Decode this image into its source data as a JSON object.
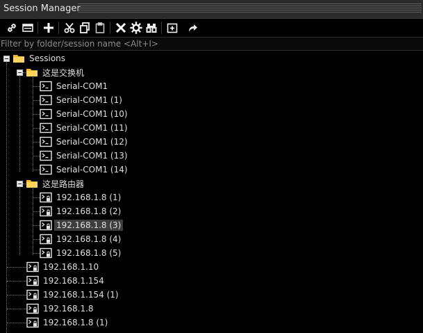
{
  "window": {
    "title": "Session Manager"
  },
  "toolbar": {
    "buttons": [
      {
        "icon": "link-icon",
        "tooltip": "Connect"
      },
      {
        "icon": "tab-icon",
        "tooltip": "Connect in Tab"
      },
      {
        "icon": "plus-icon",
        "tooltip": "New Session"
      },
      {
        "icon": "scissors-icon",
        "tooltip": "Cut"
      },
      {
        "icon": "copy-icon",
        "tooltip": "Copy"
      },
      {
        "icon": "paste-icon",
        "tooltip": "Paste"
      },
      {
        "icon": "delete-x-icon",
        "tooltip": "Delete"
      },
      {
        "icon": "gear-icon",
        "tooltip": "Properties"
      },
      {
        "icon": "binoculars-icon",
        "tooltip": "Find"
      },
      {
        "icon": "new-folder-icon",
        "tooltip": "New Folder"
      },
      {
        "icon": "share-arrow-icon",
        "tooltip": "Export"
      }
    ]
  },
  "filter": {
    "placeholder": "Filter by folder/session name <Alt+I>",
    "value": ""
  },
  "tree": {
    "root": {
      "label": "Sessions",
      "expanded": true
    },
    "folders": [
      {
        "label": "这是交换机",
        "expanded": true,
        "items": [
          {
            "label": "Serial-COM1",
            "type": "serial"
          },
          {
            "label": "Serial-COM1 (1)",
            "type": "serial"
          },
          {
            "label": "Serial-COM1 (10)",
            "type": "serial"
          },
          {
            "label": "Serial-COM1 (11)",
            "type": "serial"
          },
          {
            "label": "Serial-COM1 (12)",
            "type": "serial"
          },
          {
            "label": "Serial-COM1 (13)",
            "type": "serial"
          },
          {
            "label": "Serial-COM1 (14)",
            "type": "serial"
          }
        ]
      },
      {
        "label": "这是路由器",
        "expanded": true,
        "items": [
          {
            "label": "192.168.1.8 (1)",
            "type": "ssh"
          },
          {
            "label": "192.168.1.8 (2)",
            "type": "ssh"
          },
          {
            "label": "192.168.1.8 (3)",
            "type": "ssh",
            "selected": true
          },
          {
            "label": "192.168.1.8 (4)",
            "type": "ssh"
          },
          {
            "label": "192.168.1.8 (5)",
            "type": "ssh"
          }
        ]
      }
    ],
    "sessions": [
      {
        "label": "192.168.1.10",
        "type": "ssh"
      },
      {
        "label": "192.168.1.154",
        "type": "ssh"
      },
      {
        "label": "192.168.1.154 (1)",
        "type": "ssh"
      },
      {
        "label": "192.168.1.8",
        "type": "ssh"
      },
      {
        "label": "192.168.1.8 (1)",
        "type": "ssh"
      }
    ]
  },
  "colors": {
    "background": "#000000",
    "folder": "#f5c242",
    "selection": "#3e3e3e"
  }
}
